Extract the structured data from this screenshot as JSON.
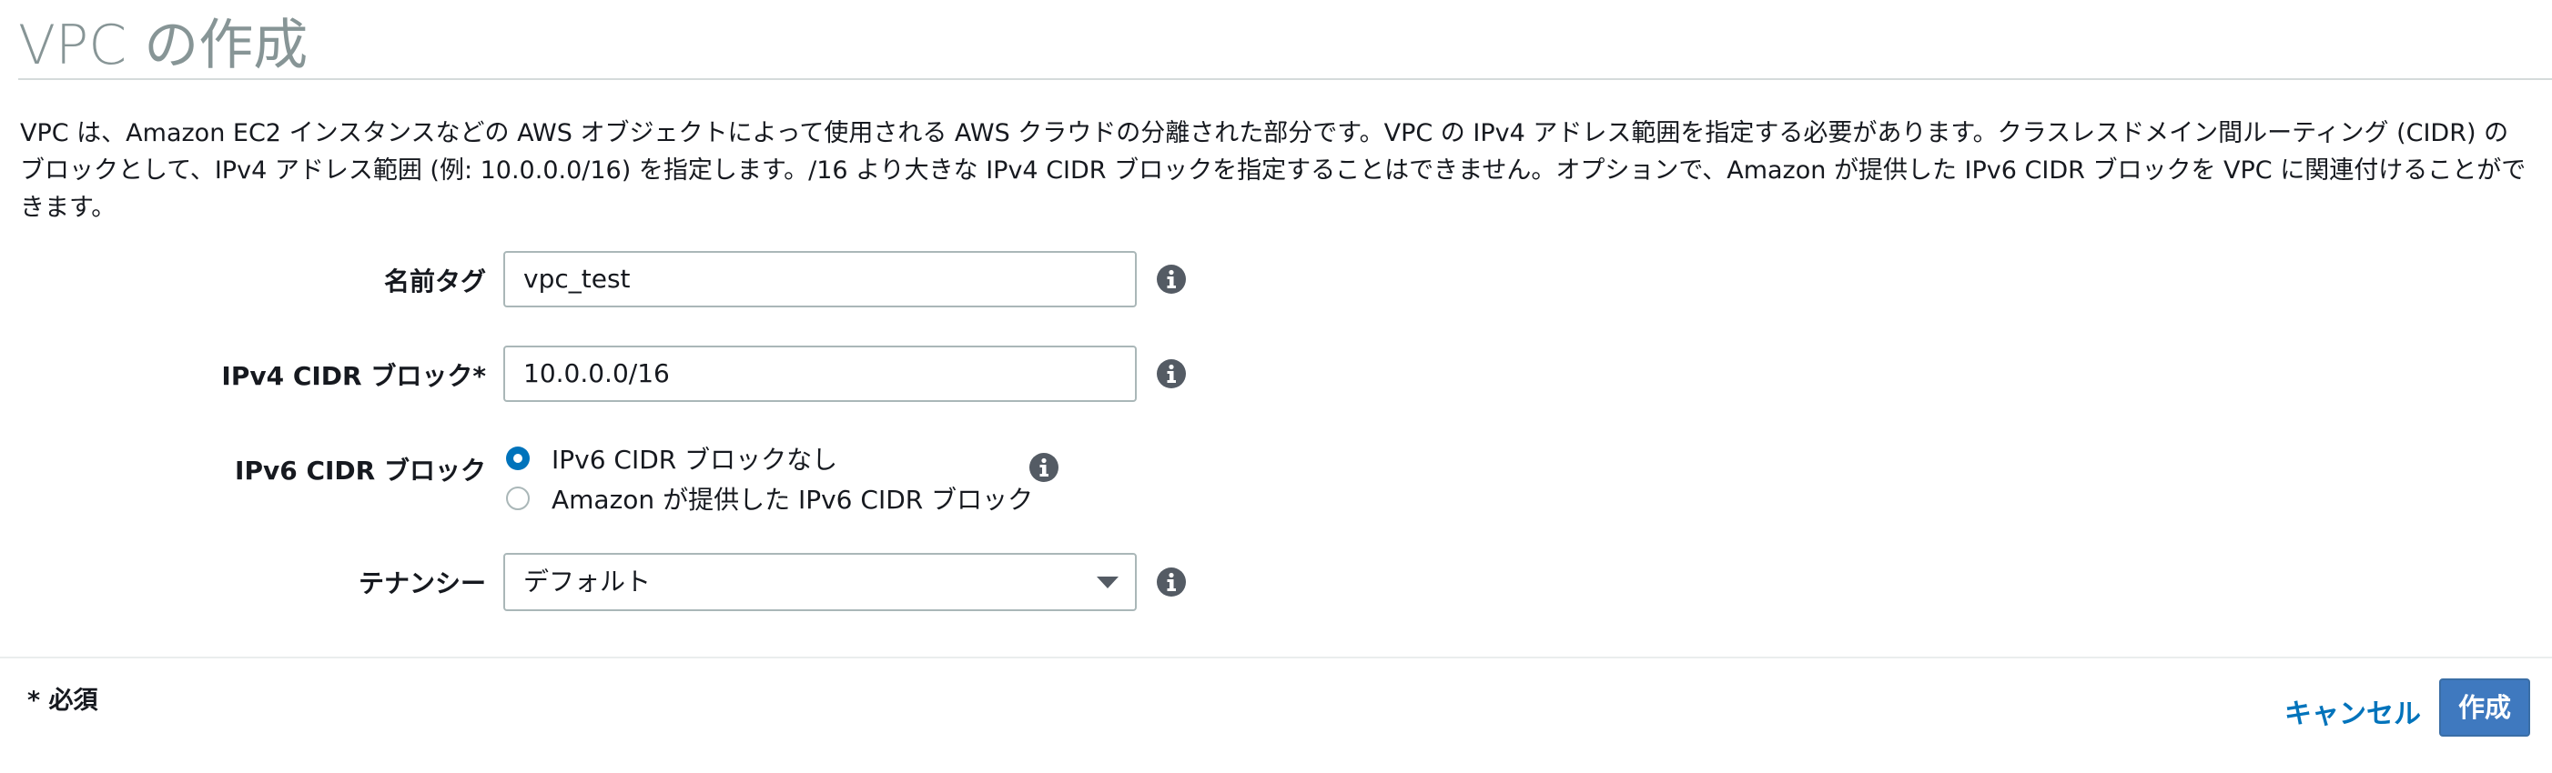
{
  "page": {
    "title": "VPC の作成",
    "description": "VPC は、Amazon EC2 インスタンスなどの AWS オブジェクトによって使用される AWS クラウドの分離された部分です。VPC の IPv4 アドレス範囲を指定する必要があります。クラスレスドメイン間ルーティング (CIDR) のブロックとして、IPv4 アドレス範囲 (例: 10.0.0.0/16) を指定します。/16 より大きな IPv4 CIDR ブロックを指定することはできません。オプションで、Amazon が提供した IPv6 CIDR ブロックを VPC に関連付けることができます。"
  },
  "form": {
    "name_tag": {
      "label": "名前タグ",
      "value": "vpc_test"
    },
    "ipv4_cidr": {
      "label": "IPv4 CIDR ブロック*",
      "value": "10.0.0.0/16"
    },
    "ipv6_cidr": {
      "label": "IPv6 CIDR ブロック",
      "options": [
        {
          "label": "IPv6 CIDR ブロックなし",
          "selected": true
        },
        {
          "label": "Amazon が提供した IPv6 CIDR ブロック",
          "selected": false
        }
      ]
    },
    "tenancy": {
      "label": "テナンシー",
      "selected": "デフォルト"
    }
  },
  "footer": {
    "required_note": "* 必須",
    "cancel_label": "キャンセル",
    "create_label": "作成"
  },
  "colors": {
    "accent": "#0073bb",
    "primary_button": "#3f79bf",
    "title_gray": "#879596",
    "info_icon": "#545b64"
  },
  "icons": {
    "info": "info-icon",
    "dropdown": "chevron-down-icon"
  }
}
